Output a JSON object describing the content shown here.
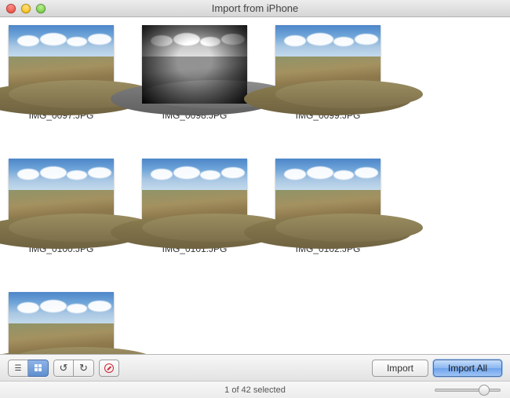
{
  "window": {
    "title": "Import from  iPhone"
  },
  "thumbs": [
    {
      "filename": "IMG_0097.JPG",
      "style": "color"
    },
    {
      "filename": "IMG_0098.JPG",
      "style": "bw_vignette"
    },
    {
      "filename": "IMG_0099.JPG",
      "style": "color"
    },
    {
      "filename": "IMG_0100.JPG",
      "style": "color"
    },
    {
      "filename": "IMG_0101.JPG",
      "style": "color"
    },
    {
      "filename": "IMG_0102.JPG",
      "style": "color"
    },
    {
      "filename": "",
      "style": "color"
    }
  ],
  "toolbar": {
    "view_list": "list-view",
    "view_grid": "grid-view",
    "rotate_left": "rotate-left",
    "rotate_right": "rotate-right",
    "delete": "delete",
    "import_label": "Import",
    "import_all_label": "Import All"
  },
  "status": {
    "text": "1 of 42 selected",
    "slider_percent": 75
  }
}
